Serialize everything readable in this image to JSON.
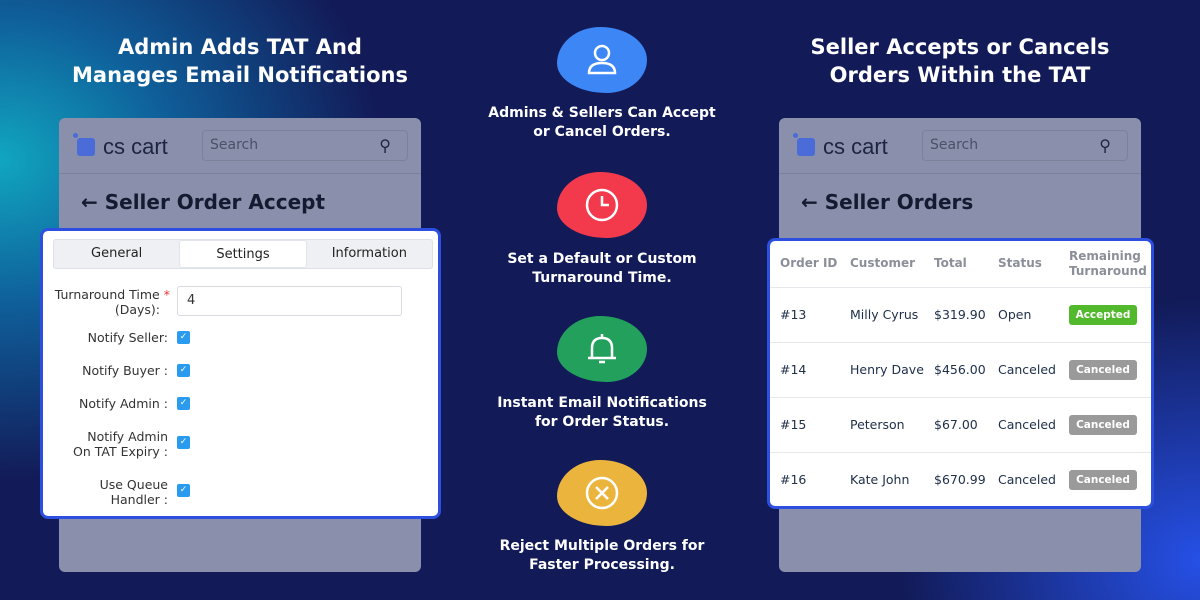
{
  "left": {
    "title_line1": "Admin Adds TAT And",
    "title_line2": "Manages Email Notifications",
    "logo": "cs cart",
    "search_placeholder": "Search",
    "page_title": "Seller Order Accept",
    "tabs": [
      "General",
      "Settings",
      "Information"
    ],
    "active_tab": "Settings",
    "turnaround_label_line1": "Turnaround Time",
    "turnaround_label_line2": "(Days):",
    "required_mark": "*",
    "turnaround_value": "4",
    "fields": [
      {
        "line1": "Notify Seller:",
        "line2": "",
        "checked": true
      },
      {
        "line1": "Notify Buyer :",
        "line2": "",
        "checked": true
      },
      {
        "line1": "Notify Admin :",
        "line2": "",
        "checked": true
      },
      {
        "line1": "Notify Admin",
        "line2": "On TAT Expiry :",
        "checked": true
      },
      {
        "line1": "Use Queue",
        "line2": "Handler :",
        "checked": true
      }
    ]
  },
  "center": {
    "features": [
      {
        "icon": "user-icon",
        "color": "#3d86f5",
        "line1": "Admins & Sellers Can Accept",
        "line2": "or Cancel Orders."
      },
      {
        "icon": "clock-icon",
        "color": "#f23a4c",
        "line1": "Set a Default or Custom",
        "line2": "Turnaround Time."
      },
      {
        "icon": "bell-icon",
        "color": "#22a05c",
        "line1": "Instant Email Notifications",
        "line2": "for Order Status."
      },
      {
        "icon": "x-circle-icon",
        "color": "#ebb53d",
        "line1": "Reject Multiple Orders for",
        "line2": "Faster Processing."
      }
    ]
  },
  "right": {
    "title_line1": "Seller Accepts or Cancels",
    "title_line2": "Orders Within the TAT",
    "logo": "cs cart",
    "search_placeholder": "Search",
    "page_title": "Seller Orders",
    "columns": [
      "Order ID",
      "Customer",
      "Total",
      "Status",
      "Remaining Turnaround"
    ],
    "rows": [
      {
        "id": "#13",
        "customer": "Milly Cyrus",
        "total": "$319.90",
        "status": "Open",
        "badge": "Accepted",
        "badge_color": "#52b82c"
      },
      {
        "id": "#14",
        "customer": "Henry Dave",
        "total": "$456.00",
        "status": "Canceled",
        "badge": "Canceled",
        "badge_color": "#9a9a9a"
      },
      {
        "id": "#15",
        "customer": "Peterson",
        "total": "$67.00",
        "status": "Canceled",
        "badge": "Canceled",
        "badge_color": "#9a9a9a"
      },
      {
        "id": "#16",
        "customer": "Kate John",
        "total": "$670.99",
        "status": "Canceled",
        "badge": "Canceled",
        "badge_color": "#9a9a9a"
      }
    ]
  }
}
